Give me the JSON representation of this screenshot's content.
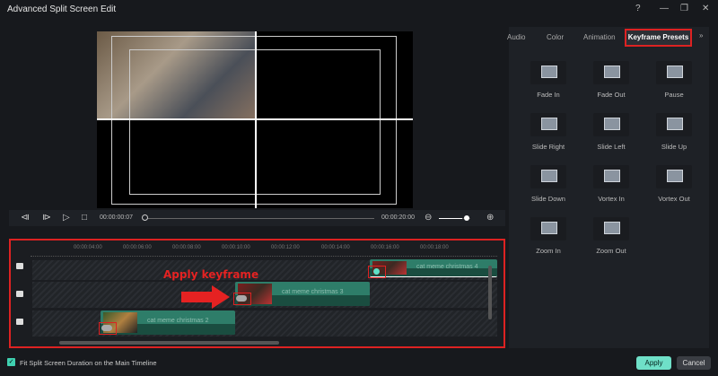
{
  "window": {
    "title": "Advanced Split Screen Edit",
    "help": "?",
    "minimize": "—",
    "restore": "❐",
    "close": "✕"
  },
  "player": {
    "current_time": "00:00:00:07",
    "total_time": "00:00:20:00",
    "zoom_level": 0.75,
    "progress": 0.0
  },
  "timeline": {
    "ticks": [
      "00:00:04:00",
      "00:00:06:00",
      "00:00:08:00",
      "00:00:10:00",
      "00:00:12:00",
      "00:00:14:00",
      "00:00:16:00",
      "00:00:18:00"
    ],
    "clips": [
      "cat meme christmas 4",
      "cat meme christmas 3",
      "cat meme christmas 2"
    ],
    "annotation": "Apply keyframe"
  },
  "panel": {
    "tabs": [
      "Audio",
      "Color",
      "Animation",
      "Keyframe Presets"
    ],
    "more": "»",
    "presets": [
      "Fade In",
      "Fade Out",
      "Pause",
      "Slide Right",
      "Slide Left",
      "Slide Up",
      "Slide Down",
      "Vortex In",
      "Vortex Out",
      "Zoom In",
      "Zoom Out"
    ]
  },
  "footer": {
    "checkbox_label": "Fit Split Screen Duration on the Main Timeline",
    "checked": true,
    "apply": "Apply",
    "cancel": "Cancel"
  },
  "colors": {
    "accent": "#6fe0c8",
    "highlight": "#dd2222",
    "clip": "#2e7d69"
  }
}
